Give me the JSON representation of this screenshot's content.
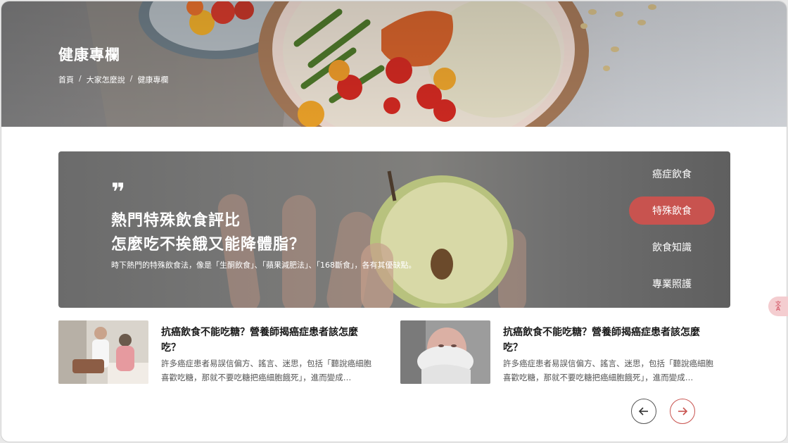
{
  "header": {
    "title": "健康專欄",
    "breadcrumb": [
      "首頁",
      "大家怎麼說",
      "健康專欄"
    ],
    "separator": "/"
  },
  "feature": {
    "quote_mark": "❞",
    "title_line1": "熱門特殊飲食評比",
    "title_line2": "怎麼吃不挨餓又能降體脂？",
    "description": "時下熱門的特殊飲食法，像是「生酮飲食」、「蘋果減肥法」、「168斷食」，各有其優缺點。"
  },
  "categories": [
    {
      "label": "癌症飲食",
      "active": false
    },
    {
      "label": "特殊飲食",
      "active": true
    },
    {
      "label": "飲食知識",
      "active": false
    },
    {
      "label": "專業照護",
      "active": false
    }
  ],
  "articles": [
    {
      "title": "抗癌飲食不能吃糖？營養師揭癌症患者該怎麼吃？",
      "excerpt": "許多癌症患者易誤信偏方、謠言、迷思，包括「聽說癌細胞喜歡吃糖，那就不要吃糖把癌細胞餓死」，進而變成…",
      "thumb_icon": "doctor-patient-photo"
    },
    {
      "title": "抗癌飲食不能吃糖？營養師揭癌症患者該怎麼吃？",
      "excerpt": "許多癌症患者易誤信偏方、謠言、迷思，包括「聽說癌細胞喜歡吃糖，那就不要吃糖把癌細胞餓死」，進而變成…",
      "thumb_icon": "newborn-baby-photo"
    }
  ],
  "pager": {
    "prev_icon": "arrow-left-icon",
    "next_icon": "arrow-right-icon"
  },
  "translate_fab": {
    "icon": "translate-icon",
    "glyph_top": "文",
    "glyph_bottom": "A"
  },
  "colors": {
    "accent": "#c8534f",
    "text_dark": "#1a1a1a",
    "text_muted": "#555555",
    "fab_bg": "#f4cdd0"
  }
}
